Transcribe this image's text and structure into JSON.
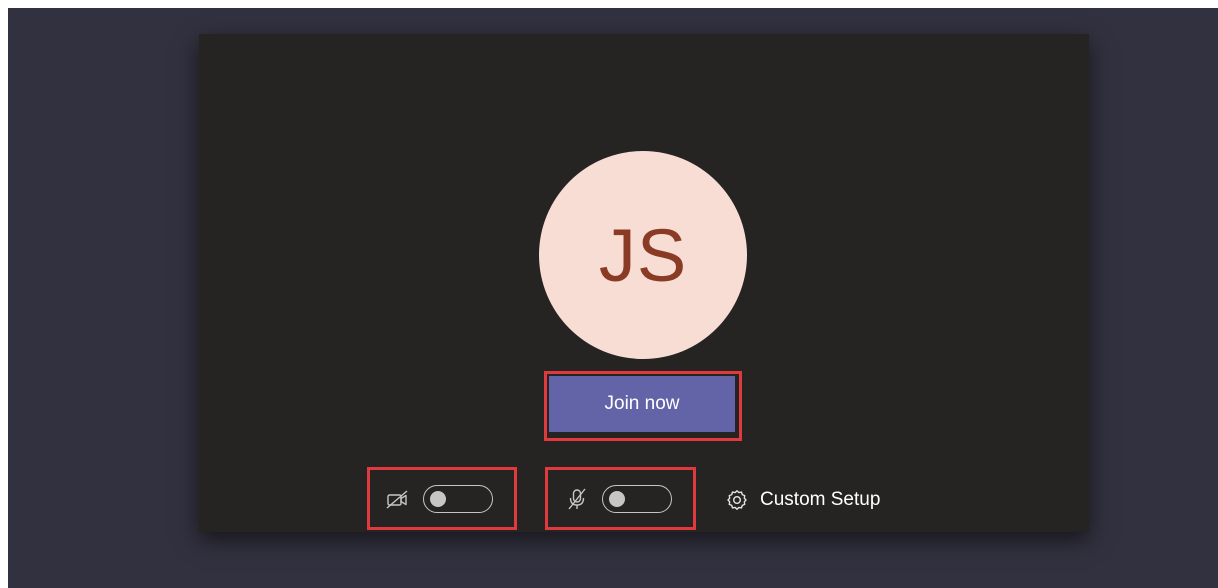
{
  "prejoin": {
    "avatar_initials": "JS",
    "join_label": "Join now",
    "camera": {
      "icon": "camera-off-icon",
      "state": "off"
    },
    "microphone": {
      "icon": "mic-off-icon",
      "state": "off"
    },
    "custom_setup_label": "Custom Setup",
    "custom_setup_icon": "gear-icon"
  },
  "colors": {
    "background": "#32313f",
    "card": "#252423",
    "avatar_bg": "#f8ddd5",
    "avatar_text": "#8a3b25",
    "join_button": "#6264a7",
    "highlight": "#e03a3e",
    "toggle": "#c8c6c4"
  }
}
